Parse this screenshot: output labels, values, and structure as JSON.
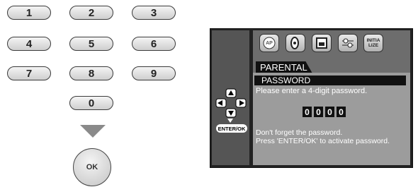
{
  "keypad": {
    "keys": [
      "1",
      "2",
      "3",
      "4",
      "5",
      "6",
      "7",
      "8",
      "9",
      "0"
    ],
    "ok_label": "OK"
  },
  "osd": {
    "icons": [
      "speaker-AP-icon",
      "disc-icon",
      "lock-icon",
      "settings-sliders-icon",
      "initialize-icon"
    ],
    "icon_text": {
      "speaker": "AP",
      "init": "INITIA LIZE"
    },
    "enter_label": "ENTER/OK",
    "tab_label": "PARENTAL",
    "title": "PASSWORD",
    "prompt": "Please enter a 4-digit password.",
    "digits": [
      "0",
      "0",
      "0",
      "0"
    ],
    "note_line1": "Don't forget the password.",
    "note_line2": "Press 'ENTER/OK' to activate password."
  }
}
